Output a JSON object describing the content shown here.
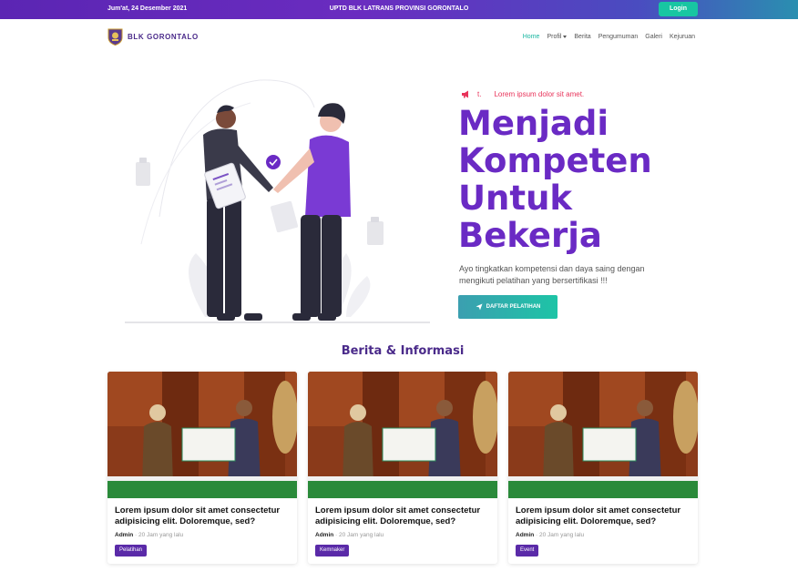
{
  "topbar": {
    "date": "Jum'at, 24 Desember 2021",
    "center": "UPTD BLK LATRANS PROVINSI GORONTALO",
    "login": "Login"
  },
  "brand": {
    "name": "BLK GORONTALO"
  },
  "nav": {
    "items": [
      {
        "label": "Home",
        "active": true
      },
      {
        "label": "Profil",
        "dropdown": true
      },
      {
        "label": "Berita"
      },
      {
        "label": "Pengumuman"
      },
      {
        "label": "Galeri"
      },
      {
        "label": "Kejuruan"
      }
    ]
  },
  "hero": {
    "kicker_prefix": "t.",
    "kicker": "Lorem ipsum dolor sit amet.",
    "title_lines": [
      "Menjadi",
      "Kompeten",
      "Untuk",
      "Bekerja"
    ],
    "description": "Ayo tingkatkan kompetensi dan daya saing dengan mengikuti pelatihan yang bersertifikasi !!!",
    "cta": "DAFTAR PELATIHAN"
  },
  "section": {
    "title": "Berita & Informasi"
  },
  "cards": [
    {
      "title": "Lorem ipsum dolor sit amet consectetur adipisicing elit. Doloremque, sed?",
      "author": "Admin",
      "time": "20 Jam yang lalu",
      "tag": "Pelatihan"
    },
    {
      "title": "Lorem ipsum dolor sit amet consectetur adipisicing elit. Doloremque, sed?",
      "author": "Admin",
      "time": "20 Jam yang lalu",
      "tag": "Kemnaker"
    },
    {
      "title": "Lorem ipsum dolor sit amet consectetur adipisicing elit. Doloremque, sed?",
      "author": "Admin",
      "time": "20 Jam yang lalu",
      "tag": "Event"
    }
  ],
  "colors": {
    "accent": "#6a2ac4",
    "teal": "#18c6a2",
    "badge": "#5a2aa8",
    "kicker": "#e8335a"
  }
}
